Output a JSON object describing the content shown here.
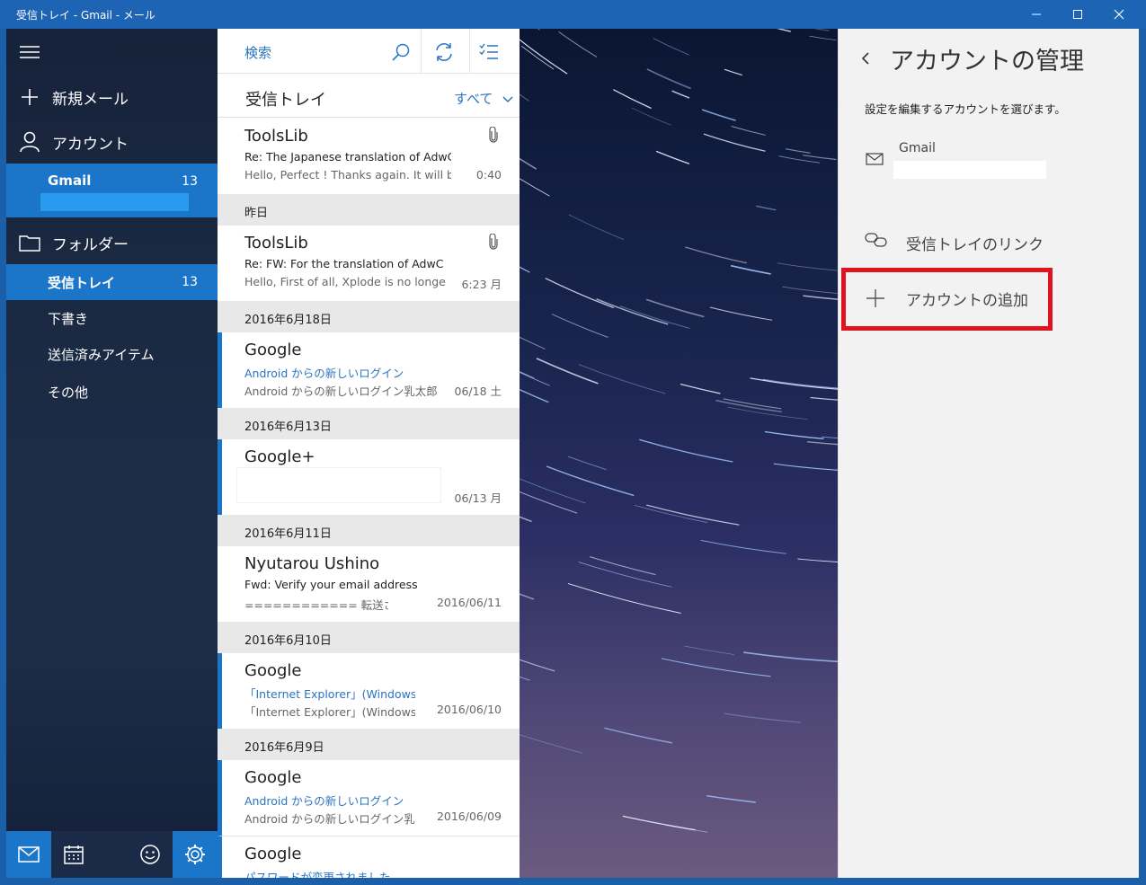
{
  "window": {
    "title": "受信トレイ - Gmail - メール"
  },
  "nav": {
    "new_mail": "新規メール",
    "accounts": "アカウント",
    "account_name": "Gmail",
    "account_count": "13",
    "folders": "フォルダー",
    "folder_items": [
      {
        "label": "受信トレイ",
        "count": "13"
      },
      {
        "label": "下書き"
      },
      {
        "label": "送信済みアイテム"
      },
      {
        "label": "その他"
      }
    ]
  },
  "list": {
    "search_placeholder": "検索",
    "header": "受信トレイ",
    "filter": "すべて",
    "messages": [
      {
        "sender": "ToolsLib",
        "subject": "Re: The Japanese translation of AdwCl",
        "preview": "Hello, Perfect ! Thanks again. It will be",
        "time": "0:40"
      },
      {
        "date_group": "昨日"
      },
      {
        "sender": "ToolsLib",
        "subject": "Re: FW: For the translation of AdwC",
        "preview": "Hello, First of all, Xplode is no longe",
        "time": "6:23 月"
      },
      {
        "date_group": "2016年6月18日"
      },
      {
        "sender": "Google",
        "subject": "Android からの新しいログイン",
        "preview": "Android からの新しいログイン乳太郎",
        "time": "06/18 土"
      },
      {
        "date_group": "2016年6月13日"
      },
      {
        "sender": "Google+",
        "time": "06/13 月"
      },
      {
        "date_group": "2016年6月11日"
      },
      {
        "sender": "Nyutarou Ushino",
        "subject": "Fwd:  Verify your email address",
        "preview": "============ 転送されたメ",
        "time": "2016/06/11"
      },
      {
        "date_group": "2016年6月10日"
      },
      {
        "sender": "Google",
        "subject": "「Internet Explorer」(Windows",
        "preview": "「Internet Explorer」(Windows",
        "time": "2016/06/10"
      },
      {
        "date_group": "2016年6月9日"
      },
      {
        "sender": "Google",
        "subject": "Android からの新しいログイン",
        "preview": "Android からの新しいログイン乳太",
        "time": "2016/06/09"
      },
      {
        "sender": "Google",
        "subject": "パスワードが変更されました"
      }
    ]
  },
  "pane": {
    "title": "アカウントの管理",
    "description": "設定を編集するアカウントを選びます。",
    "account_label": "Gmail",
    "link_inbox": "受信トレイのリンク",
    "add_account": "アカウントの追加"
  },
  "colors": {
    "accent": "#1b75c9",
    "titlebar": "#1d64b4",
    "highlight_box": "#e0141e"
  }
}
